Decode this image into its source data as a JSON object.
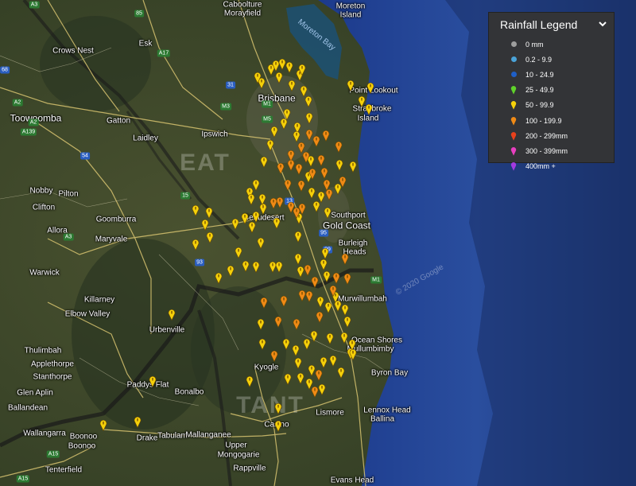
{
  "legend": {
    "title": "Rainfall Legend",
    "items": [
      {
        "label": "0 mm",
        "symbol": "dot",
        "color": "#9e9e9e"
      },
      {
        "label": "0.2 - 9.9",
        "symbol": "dot",
        "color": "#4aa3d8"
      },
      {
        "label": "10 - 24.9",
        "symbol": "dot",
        "color": "#1f5fc7"
      },
      {
        "label": "25 - 49.9",
        "symbol": "pin",
        "color": "#5fd22a"
      },
      {
        "label": "50 - 99.9",
        "symbol": "pin",
        "color": "#f5d10a"
      },
      {
        "label": "100 - 199.9",
        "symbol": "pin",
        "color": "#f08a16"
      },
      {
        "label": "200 - 299mm",
        "symbol": "pin",
        "color": "#e8411c"
      },
      {
        "label": "300 - 399mm",
        "symbol": "pin",
        "color": "#e83fc0"
      },
      {
        "label": "400mm +",
        "symbol": "pin",
        "color": "#a23ae0"
      }
    ]
  },
  "colors": {
    "yellow": "#f5d10a",
    "orange": "#f08a16",
    "ocean": "#1f3d8a",
    "land": "#3a4428"
  },
  "map": {
    "water_label": "Moreton Bay",
    "watermark": "© 2020 Google",
    "places": [
      {
        "text": "Caboolture",
        "size": "n"
      },
      {
        "text": "Morayfield",
        "size": "n"
      },
      {
        "text": "Moreton",
        "size": "n"
      },
      {
        "text": "Island",
        "size": "n"
      },
      {
        "text": "Esk",
        "size": "n"
      },
      {
        "text": "Crows Nest",
        "size": "n"
      },
      {
        "text": "Brisbane",
        "size": "b"
      },
      {
        "text": "Point Lookout",
        "size": "n"
      },
      {
        "text": "Stradbroke",
        "size": "n"
      },
      {
        "text": "Island",
        "size": "n"
      },
      {
        "text": "Toowoomba",
        "size": "b"
      },
      {
        "text": "Gatton",
        "size": "n"
      },
      {
        "text": "Laidley",
        "size": "n"
      },
      {
        "text": "Ipswich",
        "size": "n"
      },
      {
        "text": "Nobby",
        "size": "n"
      },
      {
        "text": "Pilton",
        "size": "n"
      },
      {
        "text": "Clifton",
        "size": "n"
      },
      {
        "text": "Goomburra",
        "size": "n"
      },
      {
        "text": "Allora",
        "size": "n"
      },
      {
        "text": "Maryvale",
        "size": "n"
      },
      {
        "text": "Beaudesert",
        "size": "n"
      },
      {
        "text": "Southport",
        "size": "n"
      },
      {
        "text": "Gold Coast",
        "size": "b"
      },
      {
        "text": "Burleigh",
        "size": "n"
      },
      {
        "text": "Heads",
        "size": "n"
      },
      {
        "text": "Warwick",
        "size": "n"
      },
      {
        "text": "Killarney",
        "size": "n"
      },
      {
        "text": "Elbow Valley",
        "size": "n"
      },
      {
        "text": "Murwillumbah",
        "size": "n"
      },
      {
        "text": "Urbenville",
        "size": "n"
      },
      {
        "text": "Ocean Shores",
        "size": "n"
      },
      {
        "text": "Mullumbimby",
        "size": "n"
      },
      {
        "text": "Tenterfield",
        "size": "n"
      },
      {
        "text": "Thulimbah",
        "size": "n"
      },
      {
        "text": "Applethorpe",
        "size": "n"
      },
      {
        "text": "Stanthorpe",
        "size": "n"
      },
      {
        "text": "Kyogle",
        "size": "n"
      },
      {
        "text": "Byron Bay",
        "size": "n"
      },
      {
        "text": "Glen Aplin",
        "size": "n"
      },
      {
        "text": "Paddys Flat",
        "size": "n"
      },
      {
        "text": "Bonalbo",
        "size": "n"
      },
      {
        "text": "Ballandean",
        "size": "n"
      },
      {
        "text": "Lismore",
        "size": "n"
      },
      {
        "text": "Lennox Head",
        "size": "n"
      },
      {
        "text": "Ballina",
        "size": "n"
      },
      {
        "text": "Wallangarra",
        "size": "n"
      },
      {
        "text": "Boonoo",
        "size": "n"
      },
      {
        "text": "Boonoo",
        "size": "n"
      },
      {
        "text": "Drake",
        "size": "n"
      },
      {
        "text": "Tabulam",
        "size": "n"
      },
      {
        "text": "Mallanganee",
        "size": "n"
      },
      {
        "text": "Casino",
        "size": "n"
      },
      {
        "text": "Upper",
        "size": "n"
      },
      {
        "text": "Mongogarie",
        "size": "n"
      },
      {
        "text": "Rappville",
        "size": "n"
      },
      {
        "text": "Evans Head",
        "size": "n"
      }
    ],
    "regions": [
      "EAT",
      "TANT"
    ],
    "routes": [
      "A3",
      "85",
      "A17",
      "A2",
      "68",
      "A139",
      "A2",
      "31",
      "M1",
      "M3",
      "M5",
      "54",
      "15",
      "13",
      "95",
      "99",
      "A3",
      "93",
      "M1",
      "A15",
      "A15"
    ]
  },
  "stations": [
    [
      "y",
      329,
      112
    ],
    [
      "y",
      341,
      95
    ],
    [
      "y",
      351,
      105
    ],
    [
      "y",
      364,
      92
    ],
    [
      "y",
      377,
      102
    ],
    [
      "y",
      382,
      122
    ],
    [
      "y",
      367,
      115
    ],
    [
      "y",
      389,
      156
    ],
    [
      "y",
      374,
      168
    ],
    [
      "y",
      357,
      163
    ],
    [
      "y",
      345,
      173
    ],
    [
      "y",
      340,
      190
    ],
    [
      "y",
      332,
      211
    ],
    [
      "y",
      322,
      240
    ],
    [
      "y",
      314,
      250
    ],
    [
      "y",
      322,
      280
    ],
    [
      "y",
      296,
      289
    ],
    [
      "y",
      317,
      293
    ],
    [
      "y",
      300,
      325
    ],
    [
      "y",
      328,
      313
    ],
    [
      "y",
      348,
      288
    ],
    [
      "y",
      376,
      282
    ],
    [
      "y",
      375,
      305
    ],
    [
      "y",
      409,
      326
    ],
    [
      "y",
      407,
      340
    ],
    [
      "y",
      411,
      355
    ],
    [
      "y",
      422,
      381
    ],
    [
      "y",
      403,
      387
    ],
    [
      "y",
      434,
      397
    ],
    [
      "y",
      437,
      412
    ],
    [
      "y",
      413,
      394
    ],
    [
      "y",
      395,
      430
    ],
    [
      "y",
      415,
      433
    ],
    [
      "y",
      433,
      432
    ],
    [
      "y",
      443,
      441
    ],
    [
      "y",
      441,
      452
    ],
    [
      "y",
      386,
      440
    ],
    [
      "y",
      372,
      448
    ],
    [
      "y",
      360,
      440
    ],
    [
      "y",
      330,
      440
    ],
    [
      "y",
      328,
      415
    ],
    [
      "y",
      375,
      464
    ],
    [
      "y",
      392,
      473
    ],
    [
      "y",
      407,
      463
    ],
    [
      "y",
      419,
      461
    ],
    [
      "y",
      429,
      476
    ],
    [
      "y",
      378,
      483
    ],
    [
      "y",
      389,
      490
    ],
    [
      "y",
      405,
      497
    ],
    [
      "y",
      362,
      484
    ],
    [
      "y",
      350,
      521
    ],
    [
      "y",
      350,
      543
    ],
    [
      "y",
      314,
      487
    ],
    [
      "y",
      343,
      343
    ],
    [
      "y",
      322,
      343
    ],
    [
      "y",
      309,
      342
    ],
    [
      "y",
      275,
      357
    ],
    [
      "y",
      290,
      348
    ],
    [
      "y",
      246,
      272
    ],
    [
      "y",
      263,
      275
    ],
    [
      "y",
      258,
      290
    ],
    [
      "y",
      264,
      306
    ],
    [
      "y",
      246,
      315
    ],
    [
      "y",
      216,
      403
    ],
    [
      "y",
      192,
      487
    ],
    [
      "y",
      173,
      538
    ],
    [
      "y",
      130,
      542
    ],
    [
      "y",
      324,
      105
    ],
    [
      "y",
      347,
      90
    ],
    [
      "y",
      355,
      88
    ],
    [
      "y",
      380,
      95
    ],
    [
      "y",
      388,
      135
    ],
    [
      "y",
      361,
      151
    ],
    [
      "y",
      373,
      179
    ],
    [
      "y",
      391,
      210
    ],
    [
      "y",
      388,
      230
    ],
    [
      "y",
      392,
      250
    ],
    [
      "y",
      404,
      255
    ],
    [
      "y",
      398,
      267
    ],
    [
      "y",
      412,
      275
    ],
    [
      "y",
      425,
      245
    ],
    [
      "y",
      427,
      215
    ],
    [
      "y",
      444,
      217
    ],
    [
      "y",
      441,
      115
    ],
    [
      "y",
      466,
      118
    ],
    [
      "y",
      455,
      135
    ],
    [
      "y",
      464,
      145
    ],
    [
      "y",
      331,
      270
    ],
    [
      "y",
      330,
      258
    ],
    [
      "y",
      316,
      258
    ],
    [
      "y",
      308,
      282
    ],
    [
      "y",
      375,
      333
    ],
    [
      "y",
      351,
      343
    ],
    [
      "y",
      378,
      349
    ],
    [
      "y",
      425,
      392
    ],
    [
      "y",
      444,
      453
    ],
    [
      "o",
      389,
      177
    ],
    [
      "o",
      410,
      178
    ],
    [
      "o",
      426,
      192
    ],
    [
      "o",
      366,
      203
    ],
    [
      "o",
      379,
      193
    ],
    [
      "o",
      366,
      215
    ],
    [
      "o",
      376,
      220
    ],
    [
      "o",
      353,
      219
    ],
    [
      "o",
      362,
      240
    ],
    [
      "o",
      379,
      241
    ],
    [
      "o",
      352,
      262
    ],
    [
      "o",
      366,
      268
    ],
    [
      "o",
      373,
      275
    ],
    [
      "o",
      380,
      270
    ],
    [
      "o",
      393,
      226
    ],
    [
      "o",
      408,
      225
    ],
    [
      "o",
      411,
      240
    ],
    [
      "o",
      431,
      236
    ],
    [
      "o",
      414,
      252
    ],
    [
      "o",
      434,
      333
    ],
    [
      "o",
      423,
      357
    ],
    [
      "o",
      437,
      358
    ],
    [
      "o",
      387,
      347
    ],
    [
      "o",
      396,
      362
    ],
    [
      "o",
      389,
      380
    ],
    [
      "o",
      380,
      379
    ],
    [
      "o",
      357,
      386
    ],
    [
      "o",
      332,
      388
    ],
    [
      "o",
      373,
      415
    ],
    [
      "o",
      350,
      412
    ],
    [
      "o",
      345,
      455
    ],
    [
      "o",
      402,
      406
    ],
    [
      "o",
      419,
      373
    ],
    [
      "o",
      401,
      479
    ],
    [
      "o",
      396,
      500
    ],
    [
      "o",
      398,
      185
    ],
    [
      "o",
      404,
      209
    ],
    [
      "o",
      385,
      205
    ],
    [
      "o",
      344,
      263
    ]
  ]
}
